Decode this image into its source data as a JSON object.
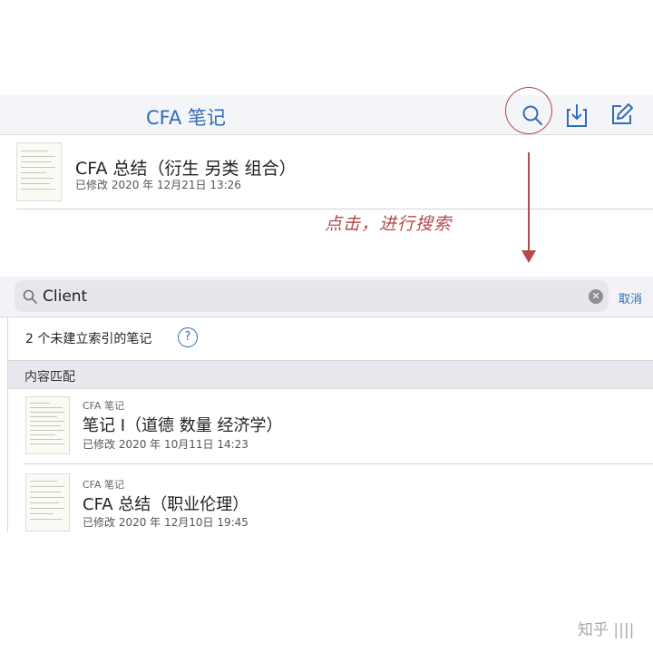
{
  "top": {
    "title": "CFA 笔记",
    "note": {
      "title": "CFA 总结（衍生 另类 组合）",
      "meta": "已修改 2020 年 12月21日 13:26"
    }
  },
  "annotation": {
    "text": "点击，进行搜索",
    "color": "#b34a4a"
  },
  "search": {
    "value": "Client",
    "cancel_label": "取消",
    "unindexed_text": "2 个未建立索引的笔记",
    "help_glyph": "?",
    "clear_glyph": "✕",
    "section_label": "内容匹配",
    "results": [
      {
        "notebook": "CFA 笔记",
        "title": "笔记 I（道德 数量 经济学）",
        "meta": "已修改 2020 年 10月11日 14:23"
      },
      {
        "notebook": "CFA 笔记",
        "title": "CFA 总结（职业伦理）",
        "meta": "已修改 2020 年 12月10日 19:45"
      }
    ]
  },
  "watermark": "知乎 ||||",
  "colors": {
    "accent": "#2f6db5",
    "annotation": "#b34a4a"
  },
  "icons": [
    "search-icon",
    "download-icon",
    "compose-icon",
    "clear-icon",
    "help-icon"
  ]
}
